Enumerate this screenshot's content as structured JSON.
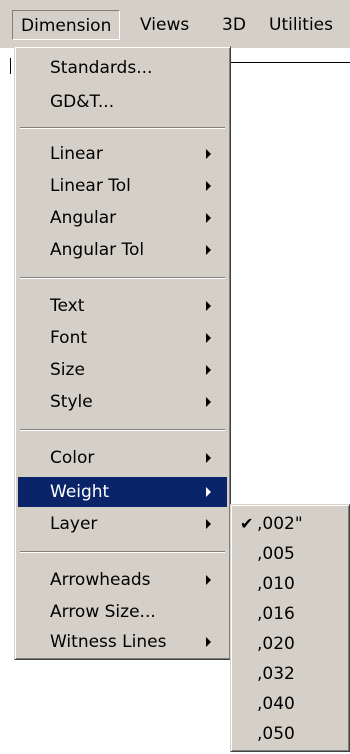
{
  "menubar": {
    "items": [
      {
        "label": "Dimension",
        "active": true
      },
      {
        "label": "Views"
      },
      {
        "label": "3D"
      },
      {
        "label": "Utilities"
      }
    ]
  },
  "dimension_menu": {
    "items": [
      {
        "label": "Standards...",
        "has_submenu": false
      },
      {
        "label": "GD&T...",
        "has_submenu": false
      },
      {
        "label": "Linear",
        "has_submenu": true
      },
      {
        "label": "Linear Tol",
        "has_submenu": true
      },
      {
        "label": "Angular",
        "has_submenu": true
      },
      {
        "label": "Angular Tol",
        "has_submenu": true
      },
      {
        "label": "Text",
        "has_submenu": true
      },
      {
        "label": "Font",
        "has_submenu": true
      },
      {
        "label": "Size",
        "has_submenu": true
      },
      {
        "label": "Style",
        "has_submenu": true
      },
      {
        "label": "Color",
        "has_submenu": true
      },
      {
        "label": "Weight",
        "has_submenu": true,
        "highlighted": true
      },
      {
        "label": "Layer",
        "has_submenu": true
      },
      {
        "label": "Arrowheads",
        "has_submenu": true
      },
      {
        "label": "Arrow Size...",
        "has_submenu": false
      },
      {
        "label": "Witness Lines",
        "has_submenu": true
      }
    ]
  },
  "weight_submenu": {
    "items": [
      {
        "label": ",002\"",
        "checked": true
      },
      {
        "label": ",005"
      },
      {
        "label": ",010"
      },
      {
        "label": ",016"
      },
      {
        "label": ",020"
      },
      {
        "label": ",032"
      },
      {
        "label": ",040"
      },
      {
        "label": ",050"
      }
    ],
    "check_glyph": "✔"
  },
  "colors": {
    "menu_face": "#d4d0c8",
    "highlight_bg": "#0a246a",
    "highlight_text": "#ffffff"
  }
}
